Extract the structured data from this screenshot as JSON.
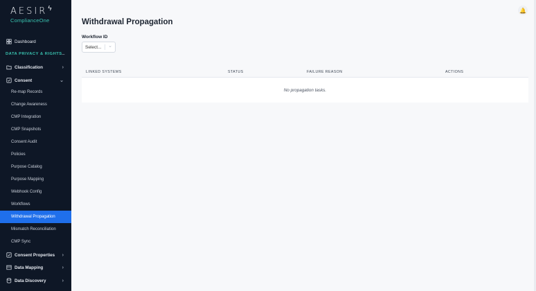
{
  "brand": {
    "name": "AESIR",
    "sub": "ComplianceOne"
  },
  "nav": {
    "dashboard": "Dashboard",
    "section": "DATA PRIVACY & RIGHTS",
    "classification": "Classification",
    "consent": "Consent",
    "consent_sub": [
      "Re-map Records",
      "Change Awareness",
      "CMP Integration",
      "CMP Snapshots",
      "Consent Audit",
      "Policies",
      "Purpose Catalog",
      "Purpose Mapping",
      "Webhook Config",
      "Workflows",
      "Withdrawal Propagation",
      "Mismatch Reconciliation",
      "CMP Sync"
    ],
    "consent_properties": "Consent Properties",
    "data_mapping": "Data Mapping",
    "data_discovery": "Data Discovery"
  },
  "main": {
    "title": "Withdrawal Propagation",
    "workflow_label": "Workflow ID",
    "workflow_value": "Select...",
    "columns": [
      "LINKED SYSTEMS",
      "STATUS",
      "FAILURE REASON",
      "ACTIONS"
    ],
    "empty_text": "No propagation tasks."
  },
  "colors": {
    "sidebar": "#0e1726",
    "accent": "#39c3b0",
    "active": "#1f6feb"
  },
  "icons": {
    "dashboard": "grid-icon",
    "classification": "folder-icon",
    "consent": "check-box-icon",
    "notifications": "bell-icon"
  }
}
